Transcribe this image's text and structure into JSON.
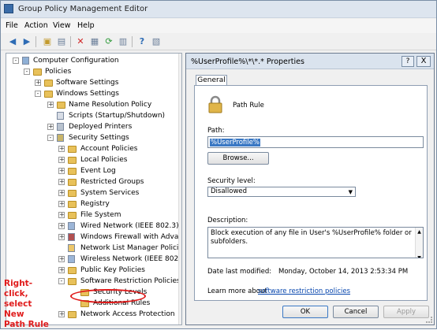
{
  "window": {
    "title": "Group Policy Management Editor"
  },
  "menu": [
    "File",
    "Action",
    "View",
    "Help"
  ],
  "toolbar": {
    "icons": [
      "back-icon",
      "forward-icon",
      "up-folder-icon",
      "show-hide-tree-icon",
      "delete-icon",
      "properties-icon",
      "refresh-icon",
      "export-icon",
      "help-icon",
      "console-icon"
    ]
  },
  "tree": {
    "items": [
      "Computer Configuration",
      "Policies",
      "Software Settings",
      "Windows Settings",
      "Name Resolution Policy",
      "Scripts (Startup/Shutdown)",
      "Deployed Printers",
      "Security Settings",
      "Account Policies",
      "Local Policies",
      "Event Log",
      "Restricted Groups",
      "System Services",
      "Registry",
      "File System",
      "Wired Network (IEEE 802.3) P",
      "Windows Firewall with Advar",
      "Network List Manager Policie",
      "Wireless Network (IEEE 802.1:",
      "Public Key Policies",
      "Software Restriction Policies",
      "Security Levels",
      "Additional Rules",
      "Network Access Protection"
    ]
  },
  "annotation": {
    "line1": "Right-click,",
    "line2": "select New",
    "line3": "Path Rule"
  },
  "dialog": {
    "title": "%UserProfile%\\*\\*.* Properties",
    "help": "?",
    "close": "X",
    "tab": "General",
    "rule_type": "Path Rule",
    "path_label": "Path:",
    "path_value": "%UserProfile%",
    "browse": "Browse...",
    "security_label": "Security level:",
    "security_value": "Disallowed",
    "description_label": "Description:",
    "description_value": "Block execution of any file in User's %UserProfile% folder or subfolders.",
    "date_label": "Date last modified:",
    "date_value": "Monday, October 14, 2013   2:53:34 PM",
    "learn_text": "Learn more about",
    "learn_link": "software restriction policies",
    "ok": "OK",
    "cancel": "Cancel",
    "apply": "Apply"
  },
  "colors": {
    "annotation": "#e01b1b",
    "selection": "#3a78c4",
    "link": "#0645ad",
    "folder": "#e8c15a"
  }
}
